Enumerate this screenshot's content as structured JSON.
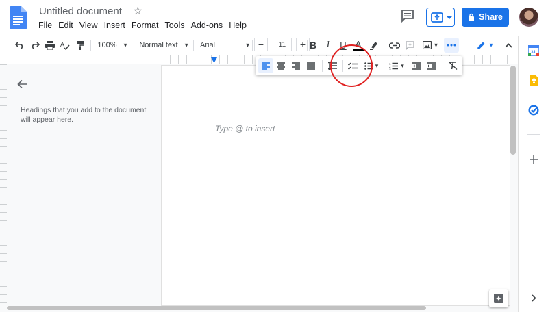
{
  "header": {
    "title": "Untitled document",
    "menu": [
      "File",
      "Edit",
      "View",
      "Insert",
      "Format",
      "Tools",
      "Add-ons",
      "Help"
    ],
    "share_label": "Share"
  },
  "toolbar": {
    "zoom": "100%",
    "style": "Normal text",
    "font": "Arial",
    "font_size": "11",
    "minus": "−",
    "plus": "+",
    "bold": "B",
    "italic": "I",
    "underline": "U",
    "text_color": "A"
  },
  "outline": {
    "hint": "Headings that you add to the document will appear here."
  },
  "document": {
    "placeholder": "Type @ to insert"
  },
  "colors": {
    "accent": "#1a73e8",
    "annotation": "#e02020"
  }
}
